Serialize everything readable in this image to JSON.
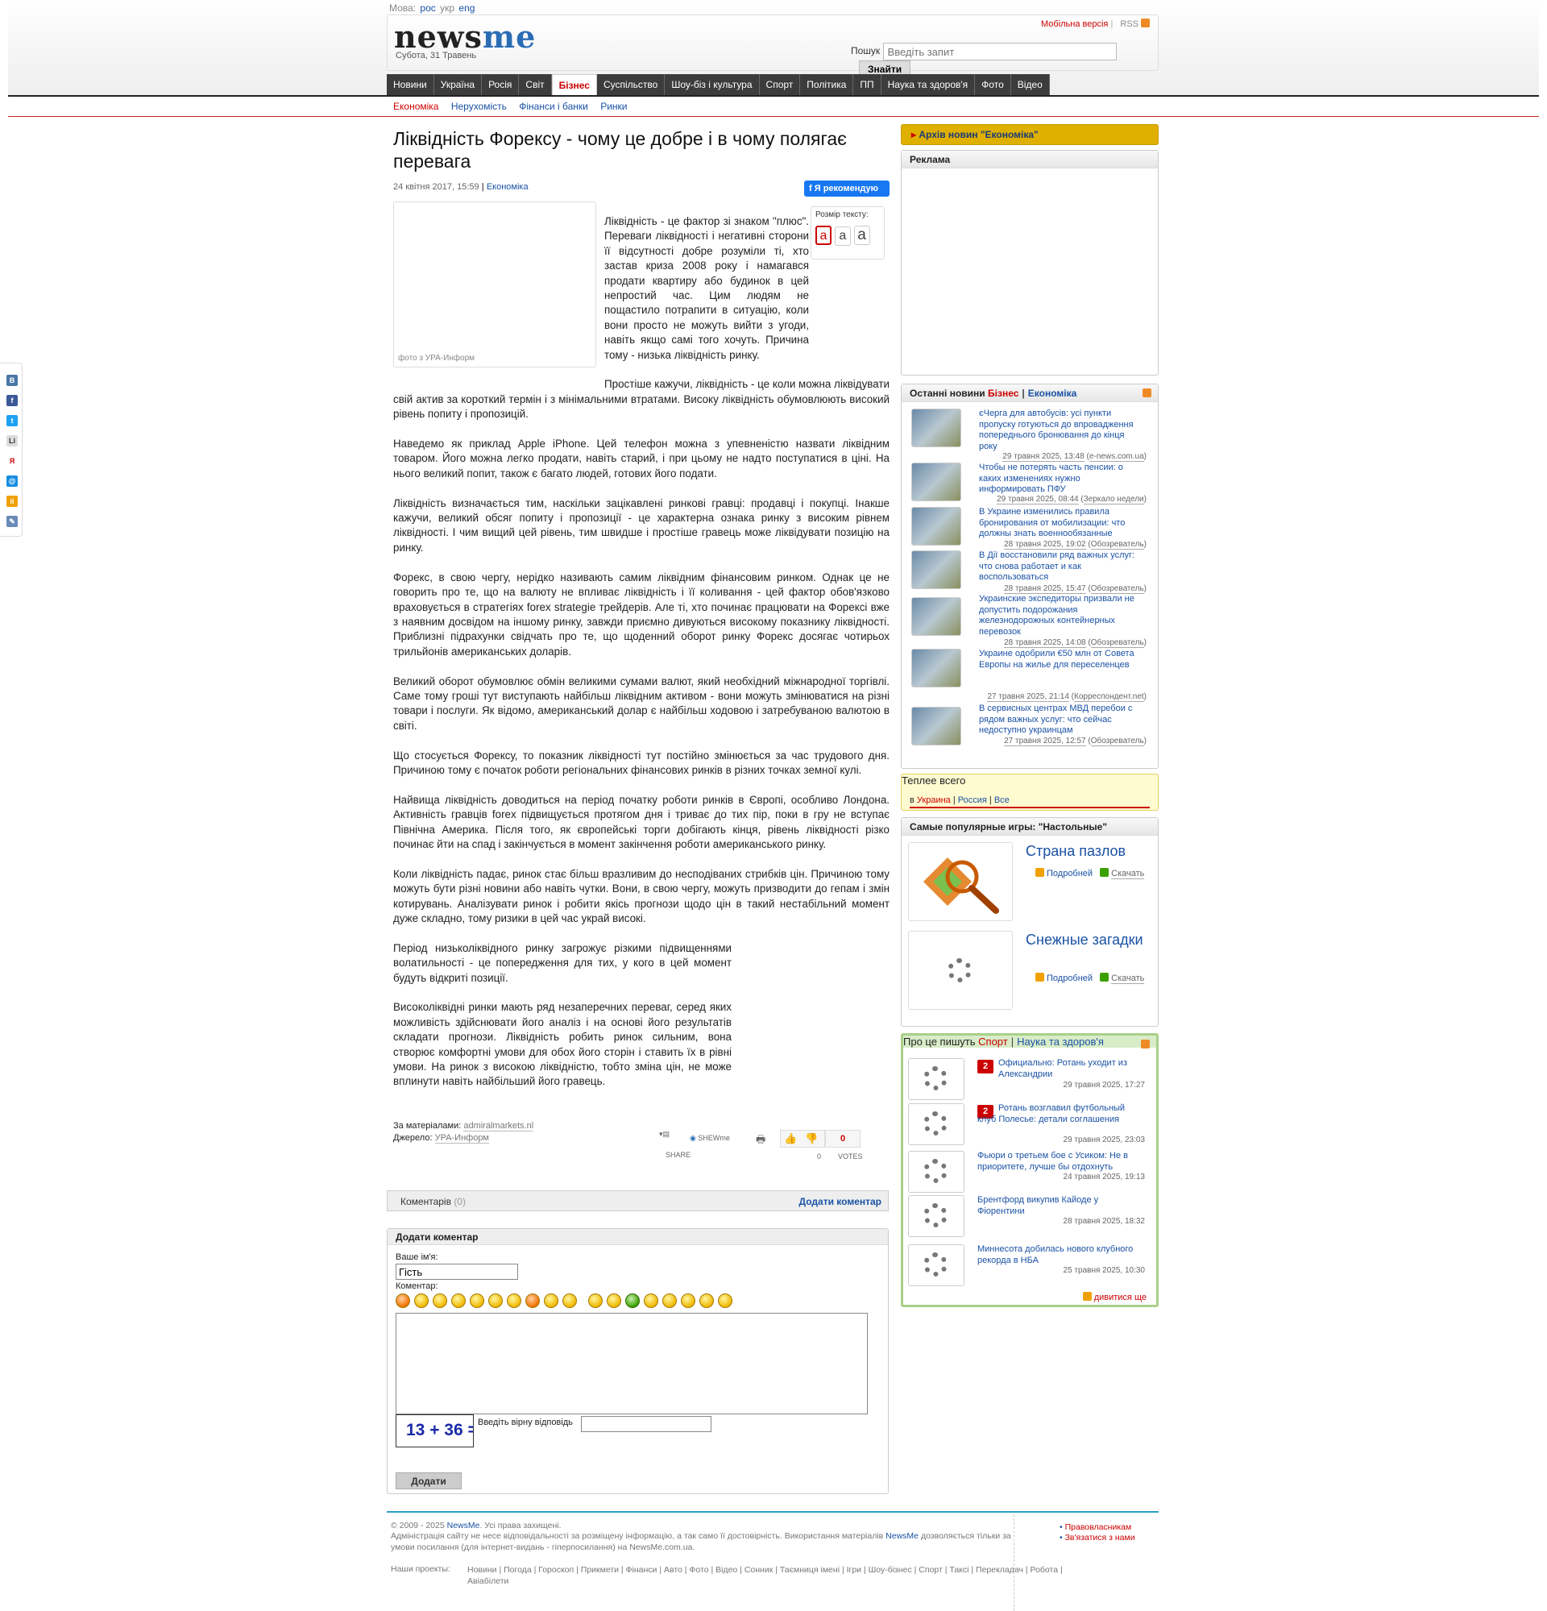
{
  "lang": {
    "label": "Мова:",
    "options": [
      "рос",
      "укр",
      "eng"
    ]
  },
  "header": {
    "logo_news": "news",
    "logo_me": "me",
    "date": "Субота, 31 Травень",
    "mobile_link": "Мобільна версія",
    "rss_label": "RSS",
    "search_label": "Пошук",
    "search_placeholder": "Введіть запит",
    "search_button": "Знайти"
  },
  "main_nav": [
    {
      "label": "Новини"
    },
    {
      "label": "Україна"
    },
    {
      "label": "Росія"
    },
    {
      "label": "Світ"
    },
    {
      "label": "Бізнес",
      "active": true
    },
    {
      "label": "Суспільство"
    },
    {
      "label": "Шоу-біз і культура"
    },
    {
      "label": "Спорт"
    },
    {
      "label": "Політика"
    },
    {
      "label": "ПП"
    },
    {
      "label": "Наука та здоров'я"
    },
    {
      "label": "Фото"
    },
    {
      "label": "Відео"
    }
  ],
  "sub_nav": [
    {
      "label": "Економіка",
      "active": true
    },
    {
      "label": "Нерухомість"
    },
    {
      "label": "Фінанси і банки"
    },
    {
      "label": "Ринки"
    }
  ],
  "article": {
    "title": "Ліквідність Форексу - чому це добре і в чому полягає перевага",
    "date": "24 квітня 2017, 15:59",
    "separator": "|",
    "category": "Економіка",
    "fb_button": "Я рекомендую",
    "photo_caption": "фото з УРА-Информ",
    "text_size_label": "Розмір тексту:",
    "text_size_options": [
      "a",
      "a",
      "a"
    ],
    "paragraphs": [
      "Ліквідність - це фактор зі знаком \"плюс\". Переваги ліквідності і негативні сторони її відсутності добре розуміли ті, хто застав криза 2008 року і намагався продати квартиру або будинок в цей непростий час. Цим людям не пощастило потрапити в ситуацію, коли вони просто не можуть вийти з угоди, навіть якщо самі того хочуть. Причина тому - низька ліквідність ринку.",
      "Простіше кажучи, ліквідність - це коли можна ліквідувати свій актив за короткий термін і з мінімальними втратами. Високу ліквідність обумовлюють високий рівень попиту і пропозицій.",
      "Наведемо як приклад Apple iPhone. Цей телефон можна з упевненістю назвати ліквідним товаром. Його можна легко продати, навіть старий, і при цьому не надто поступатися в ціні. На нього великий попит, також є багато людей, готових його подати.",
      "Ліквідність визначається тим, наскільки зацікавлені ринкові гравці: продавці і покупці. Інакше кажучи, великий обсяг попиту і пропозиції - це характерна ознака ринку з високим рівнем ліквідності. І чим вищий цей рівень, тим швидше і простіше гравець може ліквідувати позицію на ринку.",
      "Форекс, в свою чергу, нерідко називають самим ліквідним фінансовим ринком. Однак це не говорить про те, що на валюту не впливає ліквідність і її коливання - цей фактор обов'язково враховується в стратегіях forex strategie трейдерів. Але ті, хто починає працювати на Форексі вже з наявним досвідом на іншому ринку, завжди приємно дивуються високому показнику ліквідності. Приблизні підрахунки свідчать про те, що щоденний оборот ринку Форекс досягає чотирьох трильйонів американських доларів.",
      "Великий оборот обумовлює обмін великими сумами валют, який необхідний міжнародної торгівлі. Саме тому гроші тут виступають найбільш ліквідним активом - вони можуть змінюватися на різні товари і послуги. Як відомо, американський долар є найбільш ходовою і затребуваною валютою в світі.",
      "Що стосується Форексу, то показник ліквідності тут постійно змінюється за час трудового дня. Причиною тому є початок роботи регіональних фінансових ринків в різних точках земної кулі.",
      "Найвища ліквідність доводиться на період початку роботи ринків в Європі, особливо Лондона. Активність гравців forex підвищується протягом дня і триває до тих пір, поки в гру не вступає Північна Америка. Після того, як європейські торги добігають кінця, рівень ліквідності різко починає йти на спад і закінчується в момент закінчення роботи американського ринку.",
      "Коли ліквідність падає, ринок стає більш вразливим до несподіваних стрибків цін. Причиною тому можуть бути різні новини або навіть чутки. Вони, в свою чергу, можуть призводити до гепам і змін котирувань. Аналізувати ринок і робити якісь прогнози щодо цін в такий нестабільний момент дуже складно, тому ризики в цей час украй високі.",
      "Період низьколіквідного ринку загрожує різкими підвищеннями волатильності - це попередження для тих, у кого в цей момент будуть відкриті позиції.",
      "Високоліквідні ринки мають ряд незаперечних переваг, серед яких можливість здійснювати його аналіз і на основі його результатів складати прогнози. Ліквідність робить ринок сильним, вона створює комфортні умови для обох його сторін і ставить їх в рівні умови. На ринок з високою ліквідністю, тобто зміна цін, не може вплинути навіть найбільший його гравець."
    ],
    "source_label": "За матеріалами:",
    "source_value": "admiralmarkets.nl",
    "origin_label": "Джерело:",
    "origin_value": "УРА-Информ",
    "share_label": "SHARE",
    "shewme_label": "SHEWme",
    "votes_count": "0",
    "votes_label": "VOTES",
    "votes_count2": "0"
  },
  "comments": {
    "label": "Коментарів",
    "count": "(0)",
    "add_link": "Додати коментар",
    "form_title": "Додати коментар",
    "name_label": "Ваше ім'я:",
    "name_value": "Гість",
    "comment_label": "Коментар:",
    "captcha": "13 + 36 =",
    "captcha_label": "Введіть вірну відповідь",
    "submit": "Додати"
  },
  "footer": {
    "copyright": "© 2009 - 2025",
    "site": "NewsMe",
    "rights": ". Усі права захищені.",
    "disclaimer_1": "Адміністрація сайту не несе відповідальності за розміщену інформацію, а так само її достовірність. Використання матеріалів",
    "disclaimer_2": "дозволяється тільки за умови посилання (для інтернет-видань - гіперпосилання) на NewsMe.com.ua.",
    "projects_label": "Наши проекты:",
    "projects": "Новини | Погода | Гороскоп | Прикмети | Фінанси | Авто | Фото | Відео | Сонник | Таємниця імені | Ігри | Шоу-бізнес | Спорт | Таксі | Перекладач | Робота | Авіабілети",
    "right_links": [
      "Правовласникам",
      "Зв'язатися з нами"
    ]
  },
  "sidebar": {
    "archive": "Архів новин \"Економіка\"",
    "ad_title": "Реклама",
    "latest_title": "Останні новини",
    "latest_tab1": "Бізнес",
    "latest_tab2": "Економіка",
    "news": [
      {
        "title": "єЧерга для автобусів: усі пункти пропуску готуються до впровадження попереднього бронювання до кінця року",
        "date": "29 травня 2025, 13:48",
        "source": "e-news.com.ua"
      },
      {
        "title": "Чтобы не потерять часть пенсии: о каких изменениях нужно информировать ПФУ",
        "date": "29 травня 2025, 08:44",
        "source": "Зеркало недели"
      },
      {
        "title": "В Украине изменились правила бронирования от мобилизации: что должны знать военнообязанные",
        "date": "28 травня 2025, 19:02",
        "source": "Обозреватель"
      },
      {
        "title": "В Дії восстановили ряд важных услуг: что снова работает и как воспользоваться",
        "date": "28 травня 2025, 15:47",
        "source": "Обозреватель"
      },
      {
        "title": "Украинские экспедиторы призвали не допустить подорожания железнодорожных контейнерных перевозок",
        "date": "28 травня 2025, 14:08",
        "source": "Обозреватель"
      },
      {
        "title": "Украине одобрили €50 млн от Совета Европы на жилье для переселенцев",
        "date": "27 травня 2025, 21:14",
        "source": "Корреспондент.net"
      },
      {
        "title": "В сервисных центрах МВД перебои с рядом важных услуг: что сейчас недоступно украинцам",
        "date": "27 травня 2025, 12:57",
        "source": "Обозреватель"
      }
    ],
    "hot_title": "Теплее всего",
    "hot_prefix": "в",
    "hot_links": [
      "Украина",
      "Россия",
      "Все"
    ],
    "games_title": "Самые популярные игры: \"Настольные\"",
    "games": [
      {
        "title": "Страна пазлов",
        "more": "Подробней",
        "download": "Скачать"
      },
      {
        "title": "Снежные загадки",
        "more": "Подробней",
        "download": "Скачать"
      }
    ],
    "about_title": "Про це пишуть",
    "about_tab1": "Спорт",
    "about_tab2": "Наука та здоров'я",
    "about_items": [
      {
        "num": "2",
        "title": "Официально: Ротань уходит из Александрии",
        "date": "29 травня 2025, 17:27"
      },
      {
        "num": "2",
        "title": "Ротань возглавил футбольный клуб Полесье: детали соглашения",
        "date": "29 травня 2025, 23:03"
      },
      {
        "num": "",
        "title": "Фьюри о третьем бое с Усиком: Не в приоритете, лучше бы отдохнуть",
        "date": "24 травня 2025, 19:13"
      },
      {
        "num": "",
        "title": "Брентфорд викупив Кайоде у Фіорентини",
        "date": "28 травня 2025, 18:32"
      },
      {
        "num": "",
        "title": "Миннесота добилась нового клубного рекорда в НБА",
        "date": "25 травня 2025, 10:30"
      }
    ],
    "more_link": "дивитися ще"
  },
  "social": [
    "В",
    "f",
    "t",
    "Li",
    "Я",
    "@",
    "ii",
    "✎"
  ],
  "colors": {
    "accent_red": "#cc0000",
    "link_blue": "#1a52a5",
    "nav_dark": "#3c3c3c",
    "archive_gold": "#e0b000"
  }
}
